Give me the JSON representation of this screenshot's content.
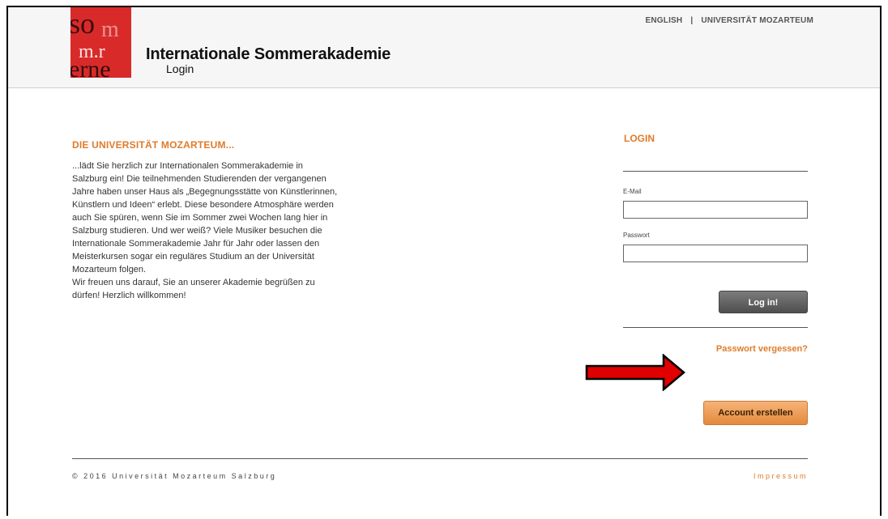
{
  "header": {
    "site_title": "Internationale Sommerakademie",
    "subtitle": "Login",
    "nav": {
      "english": "ENGLISH",
      "separator": "|",
      "university": "UNIVERSITÄT MOZARTEUM"
    },
    "logo_text": "som mer"
  },
  "intro": {
    "heading": "DIE UNIVERSITÄT MOZARTEUM...",
    "body": "...lädt Sie herzlich zur Internationalen Sommerakademie in\nSalzburg ein! Die teilnehmenden Studierenden der vergangenen\nJahre haben unser Haus als „Begegnungsstätte von Künstlerinnen,\nKünstlern und Ideen“ erlebt. Diese besondere Atmosphäre werden\nauch Sie spüren, wenn Sie im Sommer zwei Wochen lang hier in\nSalzburg studieren. Und wer weiß? Viele Musiker besuchen die\nInternationale Sommerakademie Jahr für Jahr oder lassen den\nMeisterkursen sogar ein reguläres Studium an der Universität\nMozarteum folgen.\nWir freuen uns darauf, Sie an unserer Akademie begrüßen zu\ndürfen! Herzlich willkommen!"
  },
  "login": {
    "heading": "LOGIN",
    "email_label": "E-Mail",
    "email_value": "",
    "password_label": "Passwort",
    "password_value": "",
    "login_button": "Log in!",
    "forgot_link": "Passwort vergessen?",
    "create_account_button": "Account erstellen"
  },
  "footer": {
    "copyright": "© 2016 Universität Mozarteum Salzburg",
    "impressum": "Impressum"
  },
  "colors": {
    "accent": "#e07b2a",
    "logo_red": "#d92a2a",
    "annotation_arrow": "#e00000"
  }
}
